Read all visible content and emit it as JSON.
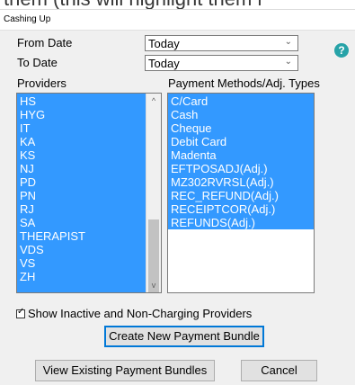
{
  "background": {
    "partial_text": "them (this will highlight them i"
  },
  "window": {
    "title": "Cashing Up"
  },
  "form": {
    "from_date_label": "From Date",
    "from_date_value": "Today",
    "to_date_label": "To Date",
    "to_date_value": "Today"
  },
  "providers": {
    "label": "Providers",
    "items": [
      "HS",
      "HYG",
      "IT",
      "KA",
      "KS",
      "NJ",
      "PD",
      "PN",
      "RJ",
      "SA",
      "THERAPIST",
      "VDS",
      "VS",
      "ZH"
    ]
  },
  "payment_methods": {
    "label": "Payment Methods/Adj. Types",
    "items": [
      "C/Card",
      "Cash",
      "Cheque",
      "Debit Card",
      "Madenta",
      "EFTPOSADJ(Adj.)",
      "MZ302RVRSL(Adj.)",
      "REC_REFUND(Adj.)",
      "RECEIPTCOR(Adj.)",
      "REFUNDS(Adj.)"
    ]
  },
  "show_inactive": {
    "checked": true,
    "label": "Show Inactive and Non-Charging Providers"
  },
  "buttons": {
    "create": "Create New Payment Bundle",
    "view": "View Existing Payment Bundles",
    "cancel": "Cancel"
  },
  "colors": {
    "selection": "#3399ff",
    "help": "#27a3a8"
  },
  "icons": {
    "help": "help-icon",
    "dropdown": "chevron-down-icon"
  }
}
